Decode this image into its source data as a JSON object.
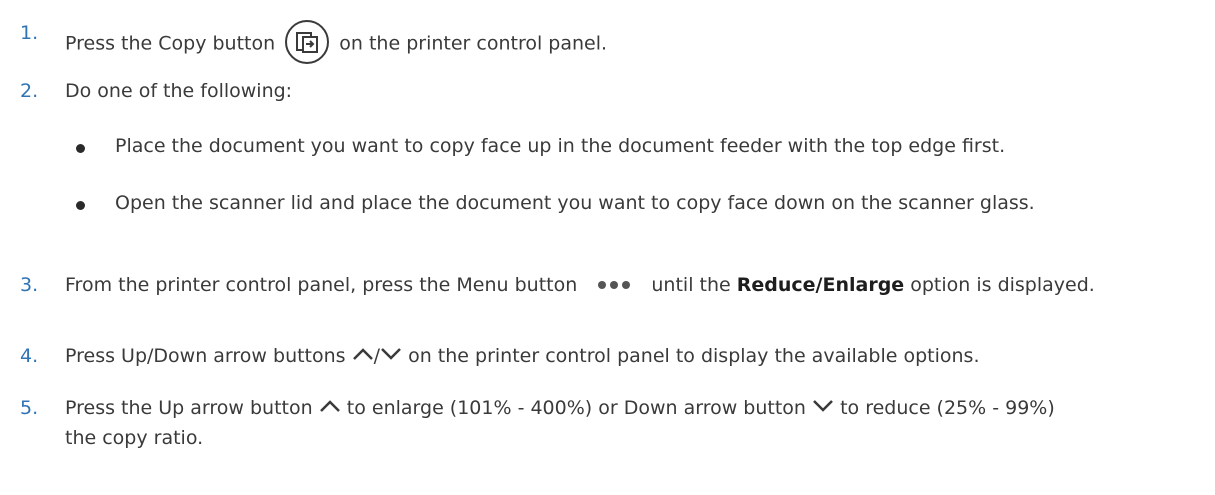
{
  "steps": [
    {
      "num": "1.",
      "before": "Press the Copy button",
      "after": "on the printer control panel."
    },
    {
      "num": "2.",
      "text": "Do one of the following:"
    },
    {
      "num": "3.",
      "before": "From the printer control panel, press the Menu button",
      "middle": "until the",
      "bold": "Reduce/Enlarge",
      "after": "option is displayed."
    },
    {
      "num": "4.",
      "before": "Press Up/Down arrow buttons",
      "sep": "/",
      "after": "on the printer control panel to display the available options."
    },
    {
      "num": "5.",
      "before": "Press the Up arrow button",
      "middle": "to enlarge (101% - 400%) or Down arrow button",
      "after": "to reduce (25% - 99%)",
      "line2": "the copy ratio."
    }
  ],
  "bullets": [
    "Place the document you want to copy face up in the document feeder with the top edge first.",
    "Open the scanner lid and place the document you want to copy face down on the scanner glass."
  ],
  "icons": {
    "copy": "copy-icon",
    "menu": "menu-dots-icon",
    "up": "up-arrow-icon",
    "down": "down-arrow-icon"
  }
}
